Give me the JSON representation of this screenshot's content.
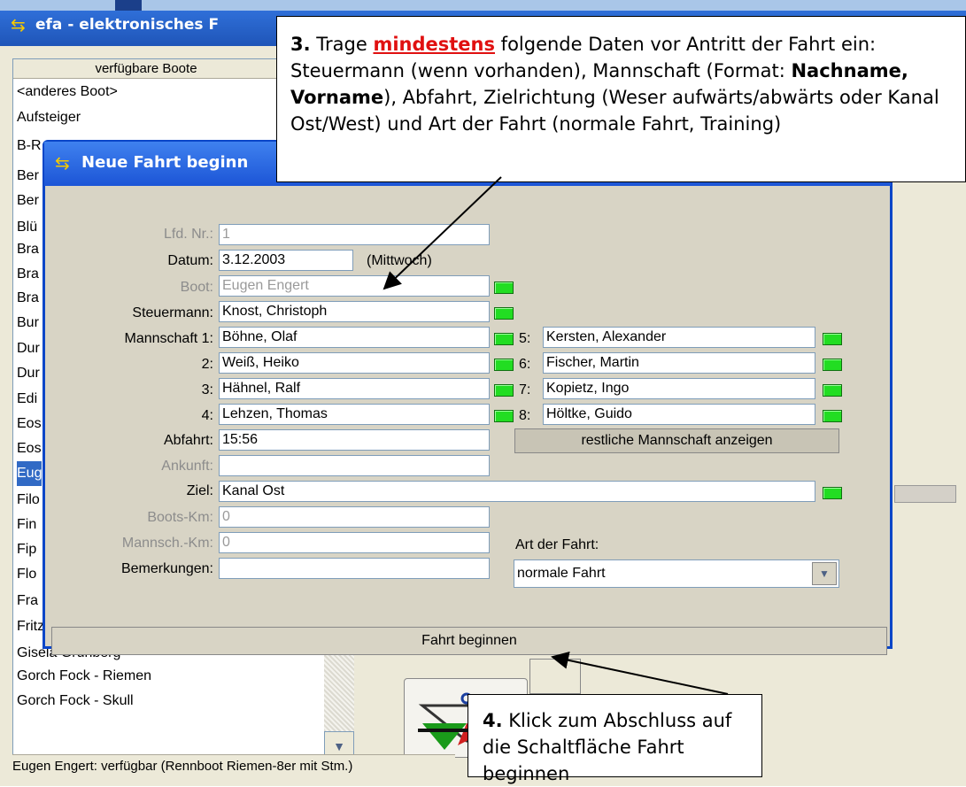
{
  "bg_window": {
    "title": "efa - elektronisches F",
    "list_header": "verfügbare Boote",
    "boats": [
      "<anderes Boot>",
      "Aufsteiger",
      "B-R",
      "Ber",
      "Ber",
      "Blü",
      "Bra",
      "Bra",
      "Bra",
      "Bur",
      "Dur",
      "Dur",
      "Edi",
      "Eos",
      "Eos",
      "Eug",
      "Filo",
      "Fin",
      "Fip",
      "Flo",
      "Fra",
      "Fritz",
      "Gisela Grünberg",
      "Gorch Fock - Riemen",
      "Gorch Fock - Skull"
    ],
    "selected_index": 15,
    "status": "Eugen Engert: verfügbar (Rennboot Riemen-8er mit Stm.)"
  },
  "dialog": {
    "title": "Neue Fahrt beginn",
    "labels": {
      "lfd": "Lfd. Nr.:",
      "datum": "Datum:",
      "boot": "Boot:",
      "steuermann": "Steuermann:",
      "m1": "Mannschaft 1:",
      "m2": "2:",
      "m3": "3:",
      "m4": "4:",
      "m5": "5:",
      "m6": "6:",
      "m7": "7:",
      "m8": "8:",
      "abfahrt": "Abfahrt:",
      "ankunft": "Ankunft:",
      "ziel": "Ziel:",
      "bootskm": "Boots-Km:",
      "mannschkm": "Mannsch.-Km:",
      "bemerkungen": "Bemerkungen:",
      "artderfahrt": "Art der Fahrt:"
    },
    "values": {
      "lfd": "1",
      "datum": "3.12.2003",
      "weekday": "(Mittwoch)",
      "boot": "Eugen Engert",
      "steuermann": "Knost, Christoph",
      "m1": "Böhne, Olaf",
      "m2": "Weiß, Heiko",
      "m3": "Hähnel, Ralf",
      "m4": "Lehzen, Thomas",
      "m5": "Kersten, Alexander",
      "m6": "Fischer, Martin",
      "m7": "Kopietz, Ingo",
      "m8": "Höltke, Guido",
      "abfahrt": "15:56",
      "ankunft": "",
      "ziel": "Kanal Ost",
      "bootskm": "0",
      "mannschkm": "0",
      "bemerkungen": "",
      "artderfahrt": "normale Fahrt"
    },
    "restliche_button": "restliche Mannschaft anzeigen",
    "fahrt_beginnen_button": "Fahrt beginnen"
  },
  "callout3": {
    "num": "3.",
    "t1": " Trage ",
    "emph": "mindestens",
    "t2": " folgende Daten vor Antritt der Fahrt ein: Steuermann (wenn vorhanden), Mannschaft (Format: ",
    "bold": "Nachname, Vorname",
    "t3": "), Abfahrt, Zielrichtung (Weser aufwärts/abwärts oder Kanal Ost/West) und Art der Fahrt (normale Fahrt, Training)"
  },
  "callout4": {
    "num": "4.",
    "text": " Klick zum Abschluss auf die Schaltfläche Fahrt beginnen"
  },
  "colors": {
    "titlebar": "#1f55b8",
    "led": "#22dd22",
    "selection": "#316ac5",
    "emphasis": "#e01010"
  }
}
